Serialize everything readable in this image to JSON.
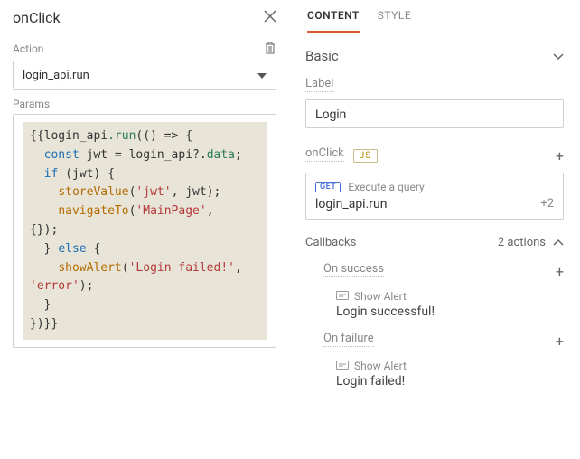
{
  "leftPanel": {
    "title": "onClick",
    "actionLabel": "Action",
    "actionValue": "login_api.run",
    "paramsLabel": "Params"
  },
  "code": {
    "l1_a": "{{",
    "l1_b": "login_api",
    "l1_c": ".run",
    "l1_d": "(() => {",
    "l2_a": "const",
    "l2_b": " jwt = ",
    "l2_c": "login_api",
    "l2_d": "?.",
    "l2_e": "data",
    "l2_f": ";",
    "l3_a": "if",
    "l3_b": " (jwt) {",
    "l4_a": "storeValue",
    "l4_b": "(",
    "l4_c": "'jwt'",
    "l4_d": ", jwt);",
    "l5_a": "navigateTo",
    "l5_b": "(",
    "l5_c": "'MainPage'",
    "l5_d": ",",
    "l6_a": "{});",
    "l7_a": "} ",
    "l7_b": "else",
    "l7_c": " {",
    "l8_a": "showAlert",
    "l8_b": "(",
    "l8_c": "'Login failed!'",
    "l8_d": ",",
    "l9_a": "'error'",
    "l9_b": ");",
    "l10_a": "}",
    "l11_a": "})}}"
  },
  "rightPanel": {
    "tabs": {
      "content": "CONTENT",
      "style": "STYLE"
    },
    "basic": "Basic",
    "labelField": "Label",
    "labelValue": "Login",
    "onClickLabel": "onClick",
    "jsBadge": "JS",
    "getBadge": "GET",
    "executeQuery": "Execute a query",
    "actionName": "login_api.run",
    "plusTwo": "+2",
    "callbacksLabel": "Callbacks",
    "actionsCount": "2 actions",
    "onSuccess": {
      "title": "On success",
      "actionType": "Show Alert",
      "message": "Login successful!"
    },
    "onFailure": {
      "title": "On failure",
      "actionType": "Show Alert",
      "message": "Login failed!"
    }
  }
}
